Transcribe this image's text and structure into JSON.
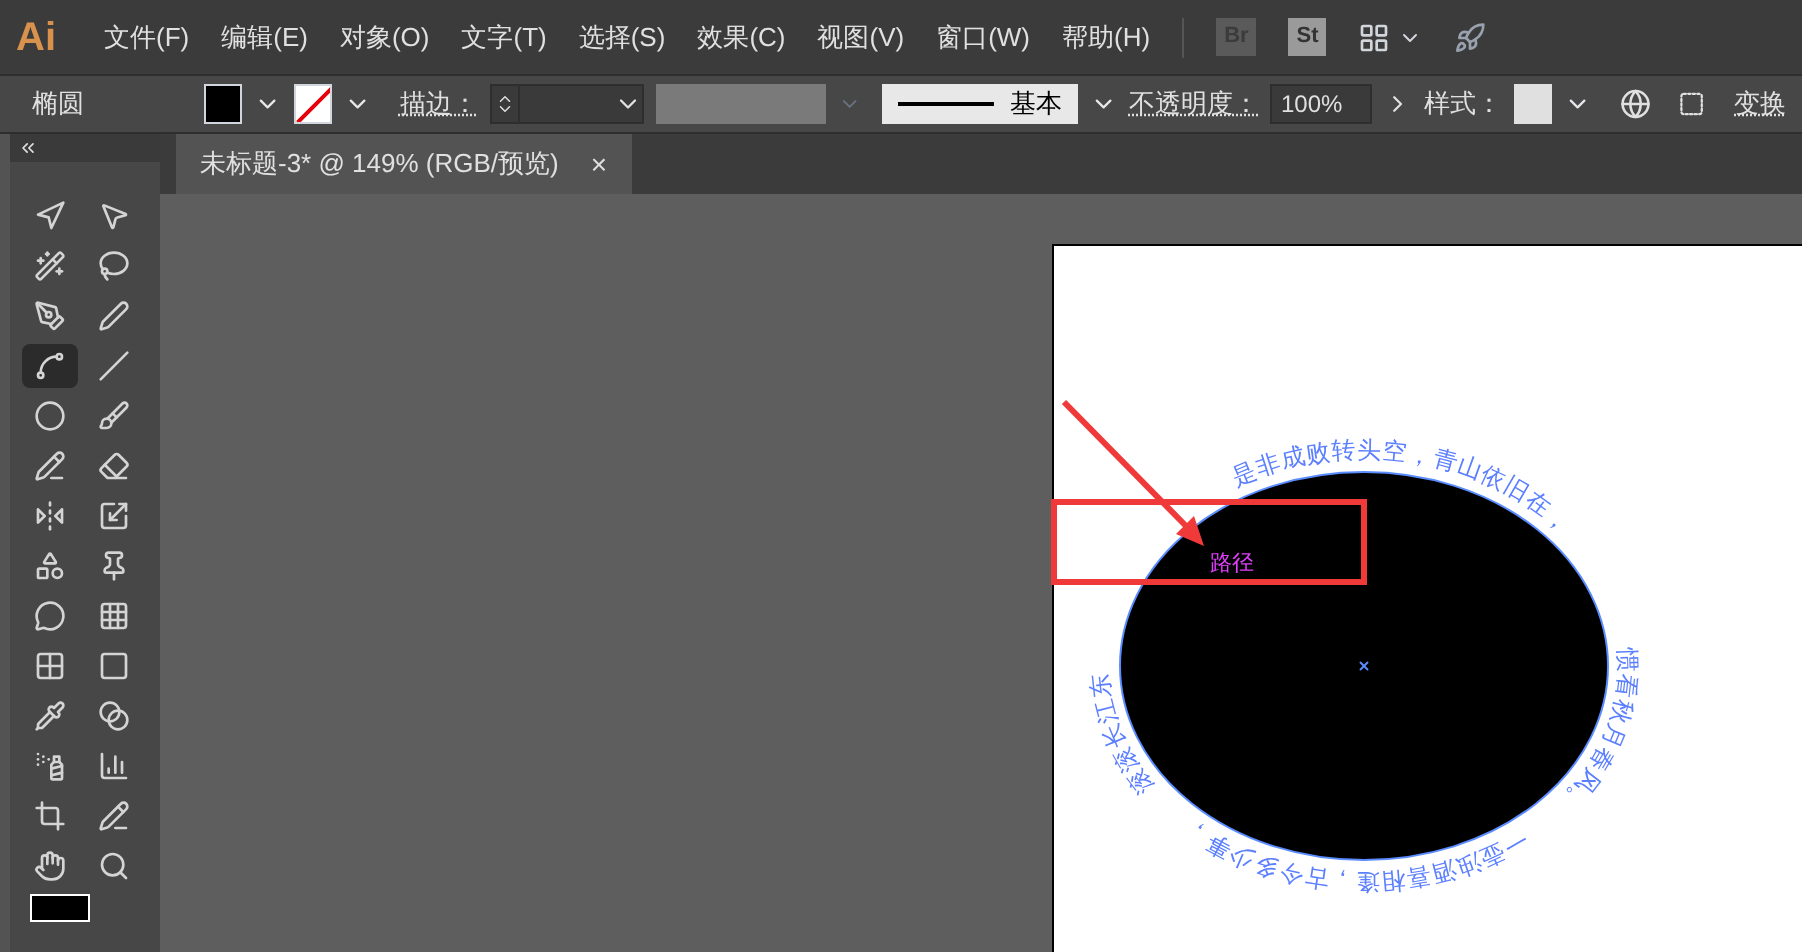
{
  "app_logo": "Ai",
  "menu": [
    "文件(F)",
    "编辑(E)",
    "对象(O)",
    "文字(T)",
    "选择(S)",
    "效果(C)",
    "视图(V)",
    "窗口(W)",
    "帮助(H)"
  ],
  "app_badges": [
    "Br",
    "St"
  ],
  "control_bar": {
    "object_type": "椭圆",
    "stroke_label": "描边：",
    "stroke_profile": "基本",
    "opacity_label": "不透明度：",
    "opacity_value": "100%",
    "style_label": "样式：",
    "transform_link": "变换"
  },
  "tools": [
    {
      "selected": false
    },
    {
      "selected": false
    },
    {
      "selected": false
    },
    {
      "selected": false
    },
    {
      "selected": false
    },
    {
      "selected": false
    },
    {
      "selected": true
    },
    {
      "selected": false
    },
    {
      "selected": false
    },
    {
      "selected": false
    },
    {
      "selected": false
    },
    {
      "selected": false
    },
    {
      "selected": false
    },
    {
      "selected": false
    },
    {
      "selected": false
    },
    {
      "selected": false
    },
    {
      "selected": false
    },
    {
      "selected": false
    },
    {
      "selected": false
    },
    {
      "selected": false
    },
    {
      "selected": false
    },
    {
      "selected": false
    },
    {
      "selected": false
    },
    {
      "selected": false
    },
    {
      "selected": false
    },
    {
      "selected": false
    },
    {
      "selected": false
    },
    {
      "selected": false
    }
  ],
  "document_tab": {
    "title": "未标题-3* @ 149% (RGB/预览)",
    "close": "×"
  },
  "artwork": {
    "path_text": [
      "滚滚长江东",
      "是非成败转头空，青山依旧在，",
      "惯看秋月春风。",
      "一壶浊酒喜相逢，古今多少事，"
    ],
    "hover_label": "路径"
  }
}
